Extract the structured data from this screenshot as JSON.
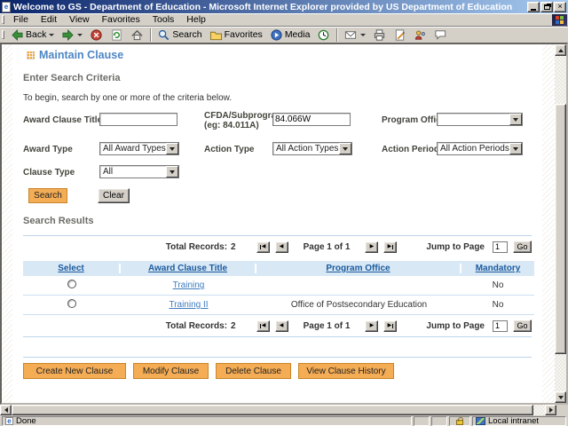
{
  "window": {
    "title": "Welcome to GS - Department of Education - Microsoft Internet Explorer provided by US Department of Education"
  },
  "menu": {
    "items": [
      "File",
      "Edit",
      "View",
      "Favorites",
      "Tools",
      "Help"
    ]
  },
  "toolbar": {
    "back": "Back",
    "search": "Search",
    "favorites": "Favorites",
    "media": "Media"
  },
  "icons": {
    "close": "×",
    "pager_first": "◀",
    "pager_prev": "◀",
    "pager_next": "▶",
    "pager_last": "▶"
  },
  "page": {
    "heading": "Maintain Clause",
    "section_title": "Enter Search Criteria",
    "intro": "To begin, search by one or more of the criteria below.",
    "form": {
      "fields": [
        {
          "label": "Award Clause Title",
          "value": ""
        },
        {
          "label": "CFDA/Subprogram",
          "label_hint": "(eg: 84.011A)",
          "value": "84.066W"
        },
        {
          "label": "Program Office",
          "value": ""
        },
        {
          "label": "Award Type",
          "value": "All Award Types"
        },
        {
          "label": "Action Type",
          "value": "All Action Types"
        },
        {
          "label": "Action Period",
          "value": "All Action Periods"
        },
        {
          "label": "Clause Type",
          "value": "All"
        }
      ],
      "search_button": "Search",
      "clear_button": "Clear"
    },
    "results": {
      "title": "Search Results",
      "pagination": {
        "total_label": "Total Records:",
        "total": "2",
        "page_text": "Page 1 of 1",
        "jump_label": "Jump to Page",
        "jump_value": "1",
        "go": "Go"
      },
      "table": {
        "headers": [
          "Select",
          "Award Clause Title",
          "Program Office",
          "Mandatory"
        ],
        "rows": [
          {
            "title": "Training",
            "office": "",
            "mandatory": "No"
          },
          {
            "title": "Training II",
            "office": "Office of Postsecondary Education",
            "mandatory": "No"
          }
        ]
      }
    },
    "actions": [
      "Create New Clause",
      "Modify Clause",
      "Delete Clause",
      "View Clause History"
    ]
  },
  "statusbar": {
    "status": "Done",
    "zone": "Local intranet"
  },
  "colors": {
    "accent": "#f4ac55",
    "accent_border": "#c9852a",
    "thbg": "#d9e8f5",
    "thtext": "#1a5a9e",
    "link": "#3f7cbf",
    "line": "#bbd5ea",
    "heading": "#4e86c4"
  }
}
